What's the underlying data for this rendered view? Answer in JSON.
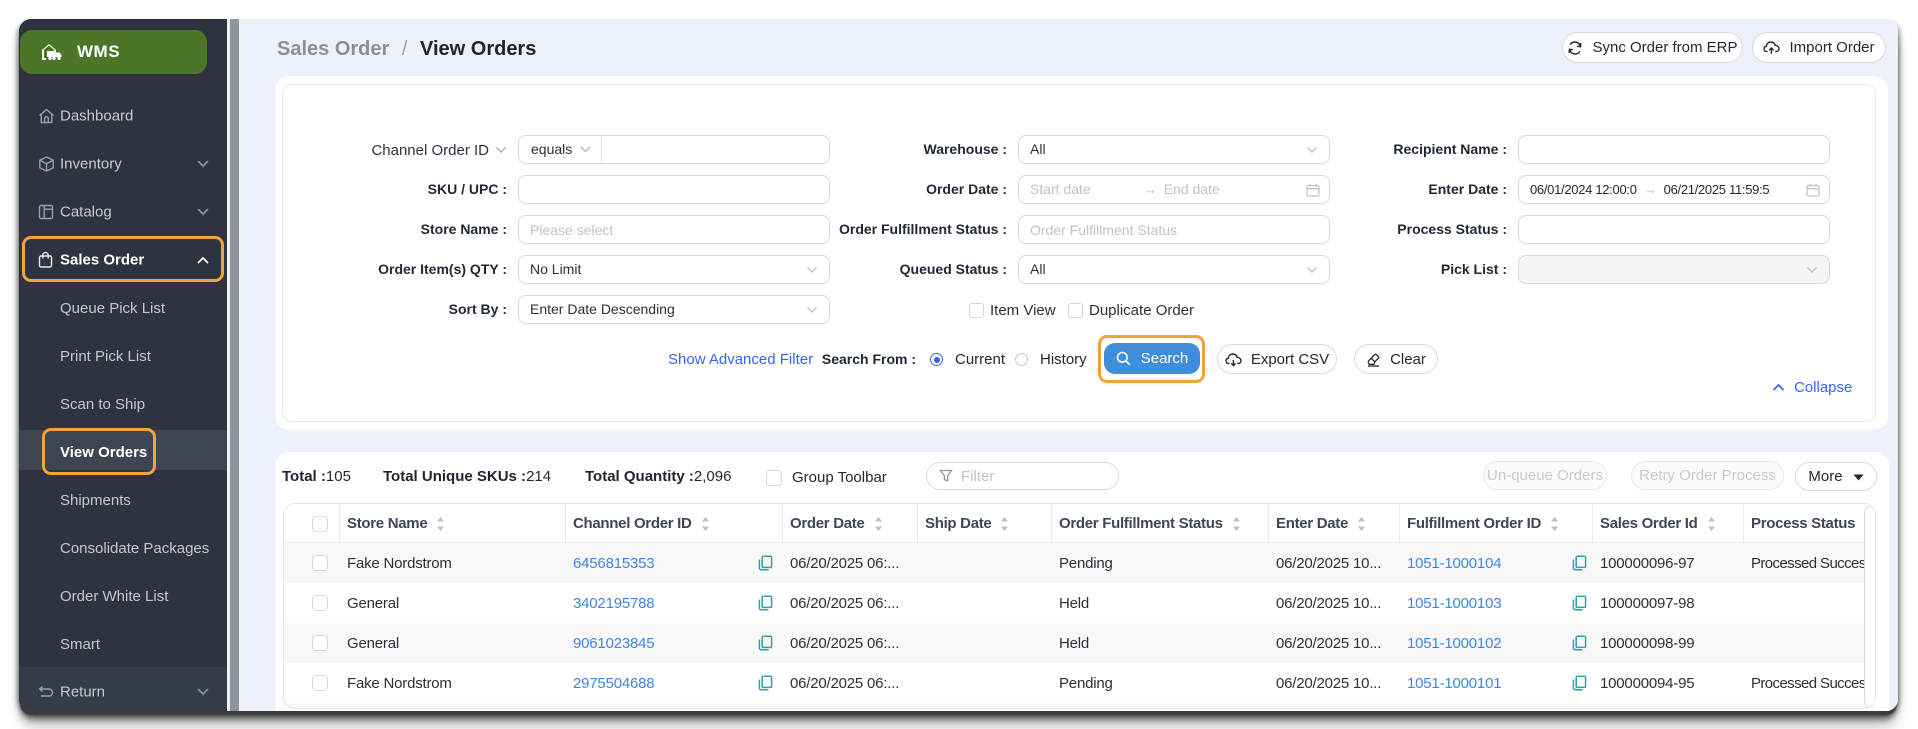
{
  "app": {
    "brand": "WMS"
  },
  "colors": {
    "sidebar_bg": "#2e333f",
    "logo_green": "#4d7a25",
    "annotation_orange": "#f0a43c",
    "main_bg": "#edf1fb",
    "search_blue": "#3e8edb",
    "link_blue": "#3565f0",
    "table_link_blue": "#3f86e0",
    "copy_teal": "#35a0a8"
  },
  "sidebar": {
    "items": [
      {
        "label": "Dashboard",
        "icon": "home-icon"
      },
      {
        "label": "Inventory",
        "icon": "box-icon",
        "chevron": "down"
      },
      {
        "label": "Catalog",
        "icon": "catalog-icon",
        "chevron": "down"
      },
      {
        "label": "Sales Order",
        "icon": "bag-icon",
        "chevron": "up",
        "active": true
      },
      {
        "label": "Return",
        "icon": "return-icon",
        "chevron": "down",
        "footer": true
      }
    ],
    "sales_order_children": [
      "Queue Pick List",
      "Print Pick List",
      "Scan to Ship",
      "View Orders",
      "Shipments",
      "Consolidate Packages",
      "Order White List",
      "Smart"
    ],
    "active_child": "View Orders"
  },
  "breadcrumb": {
    "parent": "Sales Order",
    "separator": "/",
    "current": "View Orders"
  },
  "header_actions": {
    "sync": "Sync Order from ERP",
    "import": "Import Order"
  },
  "filter_panel": {
    "channel_order_id": {
      "label": "Channel Order ID",
      "operator": "equals",
      "value": ""
    },
    "sku_upc": {
      "label": "SKU / UPC :",
      "value": ""
    },
    "store_name": {
      "label": "Store Name :",
      "placeholder": "Please select"
    },
    "order_qty": {
      "label": "Order Item(s) QTY :",
      "value": "No Limit"
    },
    "sort_by": {
      "label": "Sort By :",
      "value": "Enter Date Descending"
    },
    "warehouse": {
      "label": "Warehouse :",
      "value": "All"
    },
    "order_date": {
      "label": "Order Date :",
      "start_placeholder": "Start date",
      "end_placeholder": "End date"
    },
    "order_fulfillment_status": {
      "label": "Order Fulfillment Status :",
      "placeholder": "Order Fulfillment Status"
    },
    "queued_status": {
      "label": "Queued Status :",
      "value": "All"
    },
    "item_view": {
      "label": "Item View",
      "checked": false
    },
    "duplicate_order": {
      "label": "Duplicate Order",
      "checked": false
    },
    "recipient_name": {
      "label": "Recipient Name :",
      "value": ""
    },
    "enter_date": {
      "label": "Enter Date :",
      "start": "06/01/2024 12:00:0",
      "end": "06/21/2025 11:59:5"
    },
    "process_status": {
      "label": "Process Status :",
      "value": ""
    },
    "pick_list": {
      "label": "Pick List :",
      "value": "",
      "disabled": true
    },
    "range_arrow": "→",
    "show_advanced": "Show Advanced Filter",
    "search_from": {
      "label": "Search From :",
      "options": [
        "Current",
        "History"
      ],
      "selected": "Current"
    },
    "search_button": "Search",
    "export_button": "Export CSV",
    "clear_button": "Clear",
    "collapse": "Collapse"
  },
  "table": {
    "summary": {
      "total_label": "Total :",
      "total": "105",
      "skus_label": "Total Unique SKUs :",
      "skus": "214",
      "qty_label": "Total Quantity :",
      "qty": "2,096",
      "group_toolbar": "Group Toolbar",
      "filter_placeholder": "Filter"
    },
    "actions": {
      "unqueue": "Un-queue Orders",
      "retry": "Retry Order Process",
      "more": "More"
    },
    "columns": [
      "Store Name",
      "Channel Order ID",
      "Order Date",
      "Ship Date",
      "Order Fulfillment Status",
      "Enter Date",
      "Fulfillment Order ID",
      "Sales Order Id",
      "Process Status"
    ],
    "rows": [
      {
        "store": "Fake Nordstrom",
        "channel_order_id": "6456815353",
        "order_date": "06/20/2025 06:...",
        "ship_date": "",
        "fulfillment_status": "Pending",
        "enter_date": "06/20/2025 10...",
        "fulfillment_order_id": "1051-1000104",
        "sales_order_id": "100000096-97",
        "process_status": "Processed Success"
      },
      {
        "store": "General",
        "channel_order_id": "3402195788",
        "order_date": "06/20/2025 06:...",
        "ship_date": "",
        "fulfillment_status": "Held",
        "enter_date": "06/20/2025 10...",
        "fulfillment_order_id": "1051-1000103",
        "sales_order_id": "100000097-98",
        "process_status": ""
      },
      {
        "store": "General",
        "channel_order_id": "9061023845",
        "order_date": "06/20/2025 06:...",
        "ship_date": "",
        "fulfillment_status": "Held",
        "enter_date": "06/20/2025 10...",
        "fulfillment_order_id": "1051-1000102",
        "sales_order_id": "100000098-99",
        "process_status": ""
      },
      {
        "store": "Fake Nordstrom",
        "channel_order_id": "2975504688",
        "order_date": "06/20/2025 06:...",
        "ship_date": "",
        "fulfillment_status": "Pending",
        "enter_date": "06/20/2025 10...",
        "fulfillment_order_id": "1051-1000101",
        "sales_order_id": "100000094-95",
        "process_status": "Processed Success"
      }
    ]
  }
}
